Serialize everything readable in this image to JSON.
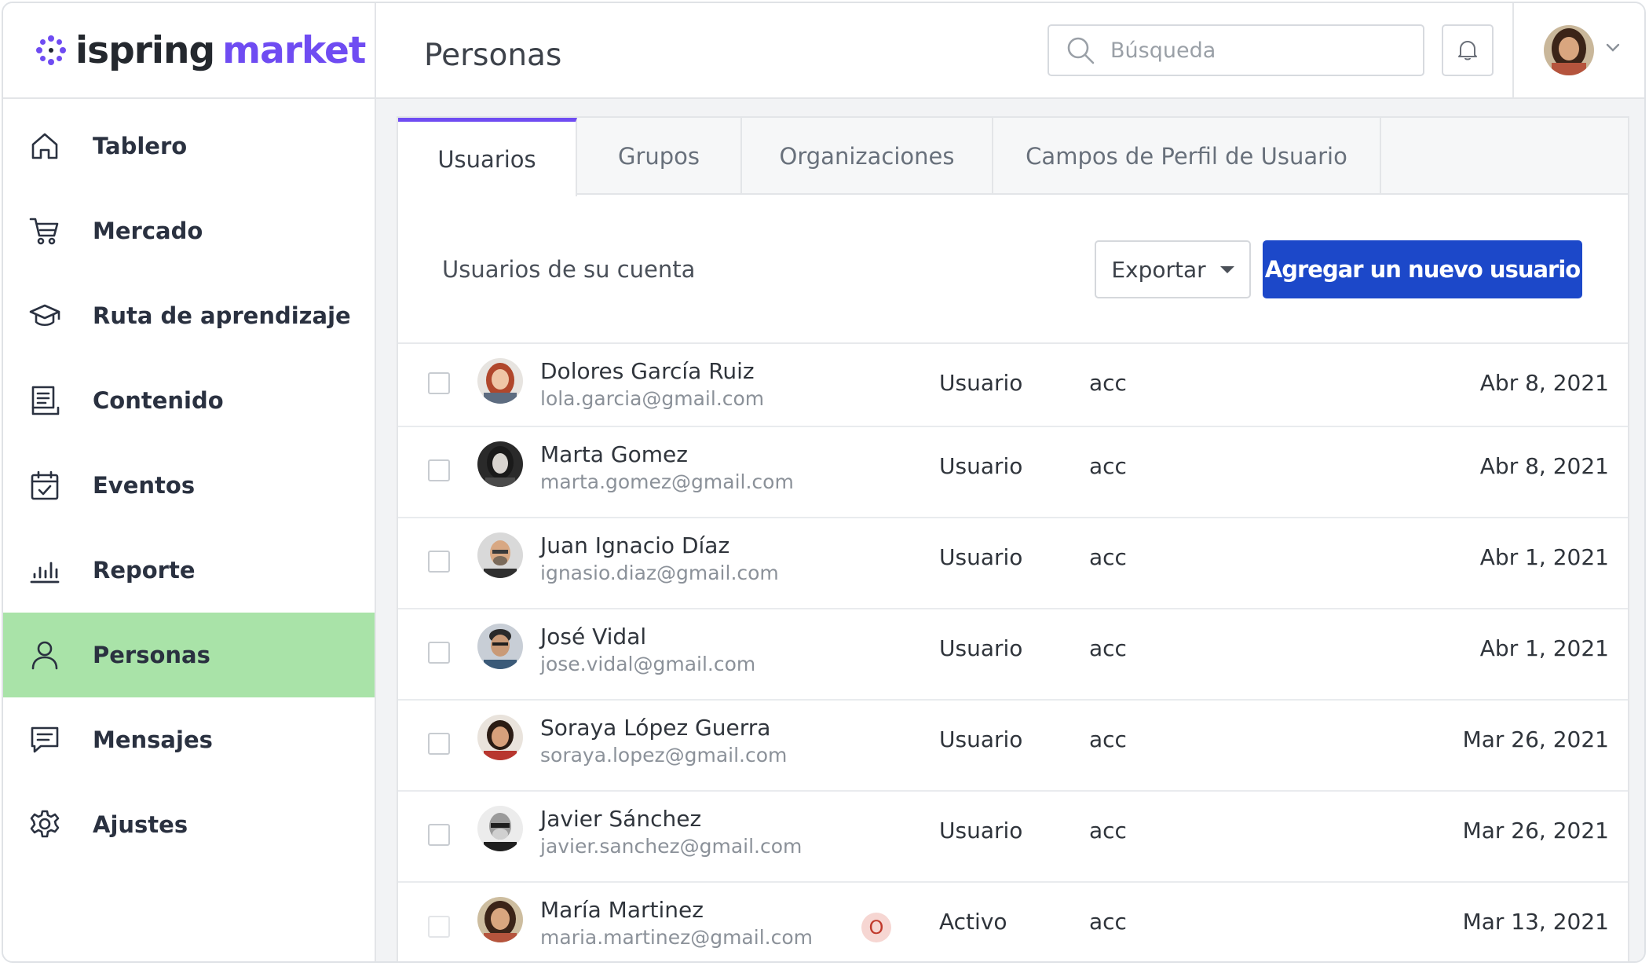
{
  "brand": {
    "word_a": "ispring",
    "word_b": "market",
    "accent": "#6f4cf2"
  },
  "sidebar": {
    "items": [
      {
        "label": "Tablero",
        "icon": "home-icon"
      },
      {
        "label": "Mercado",
        "icon": "cart-icon"
      },
      {
        "label": "Ruta de aprendizaje",
        "icon": "graduation-cap-icon"
      },
      {
        "label": "Contenido",
        "icon": "document-icon"
      },
      {
        "label": "Eventos",
        "icon": "calendar-icon"
      },
      {
        "label": "Reporte",
        "icon": "bar-chart-icon"
      },
      {
        "label": "Personas",
        "icon": "person-icon",
        "active": true
      },
      {
        "label": "Mensajes",
        "icon": "message-icon"
      },
      {
        "label": "Ajustes",
        "icon": "gear-icon"
      }
    ],
    "active_color": "#a9e3a8"
  },
  "header": {
    "title": "Personas",
    "search": {
      "placeholder": "Búsqueda"
    }
  },
  "tabs": [
    {
      "label": "Usuarios",
      "active": true
    },
    {
      "label": "Grupos"
    },
    {
      "label": "Organizaciones"
    },
    {
      "label": "Campos de Perfil de Usuario"
    }
  ],
  "toolbar": {
    "subtitle": "Usuarios de su cuenta",
    "export_label": "Exportar",
    "add_label": "Agregar un nuevo usuario",
    "add_color": "#1c48c9"
  },
  "users": [
    {
      "name": "Dolores García Ruiz",
      "email": "lola.garcia@gmail.com",
      "role": "Usuario",
      "account": "acc",
      "date": "Abr 8, 2021"
    },
    {
      "name": "Marta Gomez",
      "email": "marta.gomez@gmail.com",
      "role": "Usuario",
      "account": "acc",
      "date": "Abr 8, 2021"
    },
    {
      "name": "Juan Ignacio Díaz",
      "email": "ignasio.diaz@gmail.com",
      "role": "Usuario",
      "account": "acc",
      "date": "Abr 1, 2021"
    },
    {
      "name": "José Vidal",
      "email": "jose.vidal@gmail.com",
      "role": "Usuario",
      "account": "acc",
      "date": "Abr 1, 2021"
    },
    {
      "name": "Soraya López Guerra",
      "email": "soraya.lopez@gmail.com",
      "role": "Usuario",
      "account": "acc",
      "date": "Mar 26, 2021"
    },
    {
      "name": "Javier Sánchez",
      "email": "javier.sanchez@gmail.com",
      "role": "Usuario",
      "account": "acc",
      "date": "Mar 26, 2021"
    },
    {
      "name": "María Martinez",
      "email": "maria.martinez@gmail.com",
      "role": "Activo",
      "account": "acc",
      "date": "Mar 13, 2021",
      "badge": "O"
    }
  ]
}
